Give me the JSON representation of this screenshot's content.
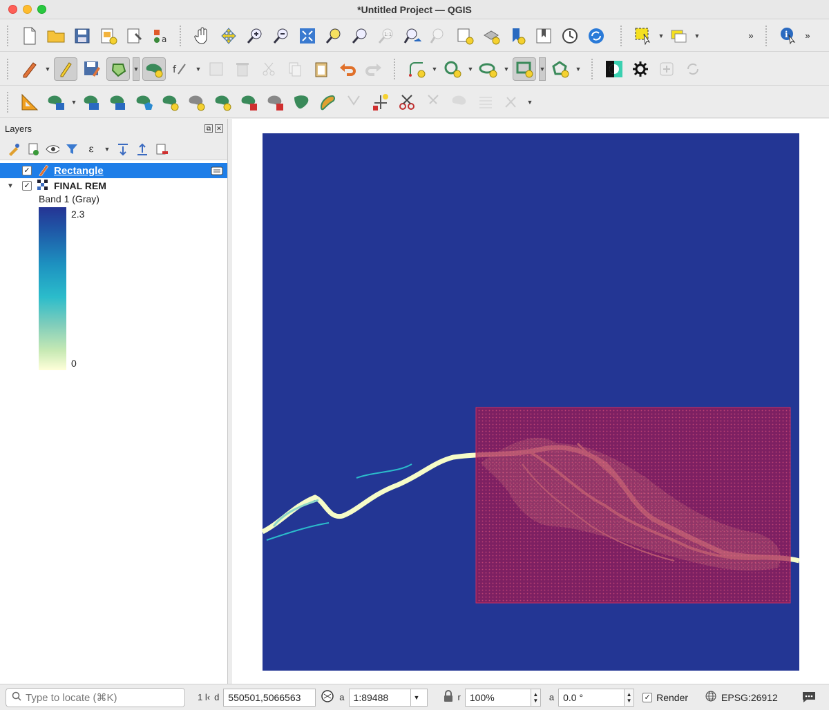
{
  "window": {
    "title": "*Untitled Project — QGIS"
  },
  "layers_panel": {
    "title": "Layers",
    "layers": [
      {
        "name": "Rectangle",
        "checked": "✓",
        "selected": true
      },
      {
        "name": "FINAL REM",
        "checked": "✓",
        "expanded": true
      }
    ],
    "legend": {
      "band": "Band 1 (Gray)",
      "max": "2.3",
      "min": "0"
    }
  },
  "colors": {
    "map_background": "#233694",
    "overlay_fill": "#a0184f",
    "selection": "#1e7ee8",
    "ramp_high": "#253494",
    "ramp_mid": "#2bbccb",
    "ramp_low": "#ffffd9"
  },
  "statusbar": {
    "locate_placeholder": "Type to locate (⌘K)",
    "coord_label": "1 l‹",
    "coord_prefix": "d",
    "coordinate": "550501,5066563",
    "scale_prefix": "a",
    "scale": "1:89488",
    "magnifier_prefix": "r",
    "magnifier": "100%",
    "rotation_prefix": "a",
    "rotation": "0.0 °",
    "render_label": "Render",
    "render_checked": "✓",
    "crs": "EPSG:26912"
  }
}
